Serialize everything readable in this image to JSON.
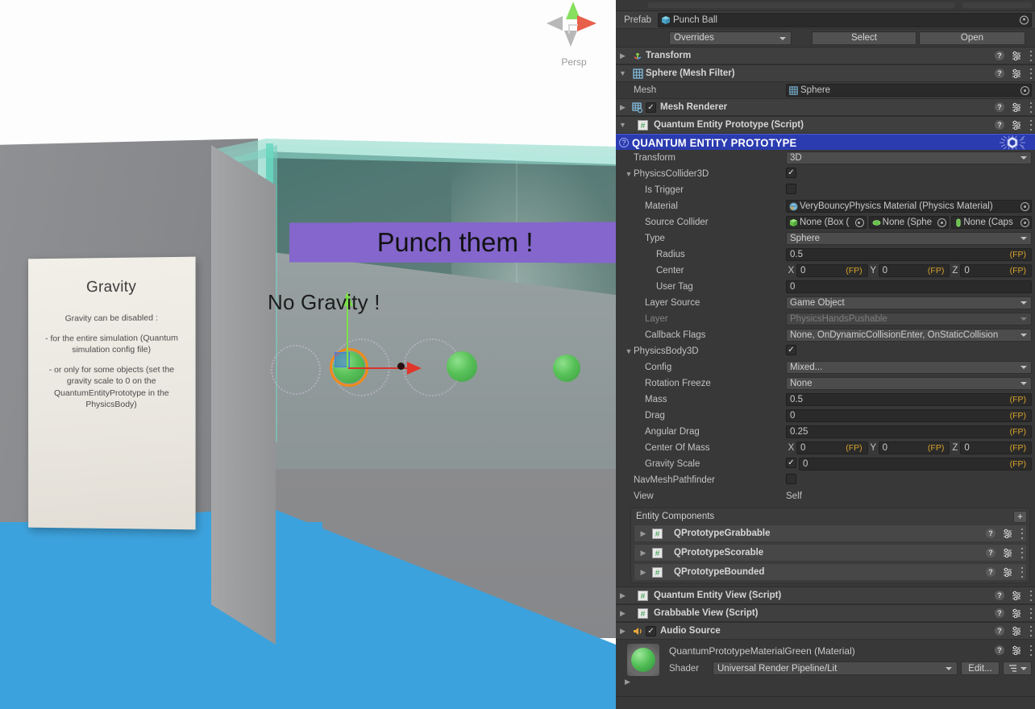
{
  "scene": {
    "gizmo": {
      "label": "Persp",
      "name": "scene-view-gizmo"
    },
    "gravity_panel": {
      "title": "Gravity",
      "line1": "Gravity can be disabled :",
      "line2": "- for the entire simulation (Quantum simulation config file)",
      "line3": "- or only for some objects (set the gravity scale to 0 on the QuantumEntityPrototype in the PhysicsBody)"
    },
    "banner_text": "Punch them !",
    "no_gravity_text": "No Gravity !",
    "colors": {
      "floor": "#3ca2dd",
      "banner": "#8466cc",
      "glass": "#91dbcd",
      "sphere": "#52bf55",
      "selection_ring": "#f08a1a",
      "axis_y": "#7ce04a",
      "axis_x": "#d9342b"
    }
  },
  "inspector": {
    "prefab": {
      "label": "Prefab",
      "value": "Punch Ball",
      "overrides_label": "Overrides",
      "select_label": "Select",
      "open_label": "Open"
    },
    "components": [
      {
        "title": "Transform",
        "icon": "transform-icon",
        "expanded": false,
        "has_checkbox": false
      },
      {
        "title": "Sphere (Mesh Filter)",
        "icon": "mesh-filter-icon",
        "expanded": true,
        "has_checkbox": false
      },
      {
        "title": "Mesh Renderer",
        "icon": "mesh-renderer-icon",
        "expanded": false,
        "has_checkbox": true,
        "checked": true
      },
      {
        "title": "Quantum Entity Prototype (Script)",
        "icon": "script-icon",
        "expanded": true,
        "has_checkbox": false
      }
    ],
    "mesh_row": {
      "label": "Mesh",
      "value": "Sphere"
    },
    "quantum_banner": {
      "title": "QUANTUM ENTITY PROTOTYPE"
    },
    "fields": {
      "transform": {
        "label": "Transform",
        "value": "3D"
      },
      "physics_collider_3d": {
        "label": "PhysicsCollider3D",
        "checked": true
      },
      "is_trigger": {
        "label": "Is Trigger",
        "checked": false
      },
      "material": {
        "label": "Material",
        "value": "VeryBouncyPhysics Material (Physics Material)"
      },
      "source_collider": {
        "label": "Source Collider",
        "values": [
          "None (Box (",
          "None (Sphe",
          "None (Caps"
        ]
      },
      "type": {
        "label": "Type",
        "value": "Sphere"
      },
      "radius": {
        "label": "Radius",
        "value": "0.5",
        "suffix": "(FP)"
      },
      "center": {
        "label": "Center",
        "x": "0",
        "y": "0",
        "z": "0",
        "suffix": "(FP)"
      },
      "user_tag": {
        "label": "User Tag",
        "value": "0"
      },
      "layer_source": {
        "label": "Layer Source",
        "value": "Game Object"
      },
      "layer": {
        "label": "Layer",
        "value": "PhysicsHandsPushable",
        "disabled": true
      },
      "callback_flags": {
        "label": "Callback Flags",
        "value": "None, OnDynamicCollisionEnter, OnStaticCollision"
      },
      "physics_body_3d": {
        "label": "PhysicsBody3D",
        "checked": true
      },
      "config": {
        "label": "Config",
        "value": "Mixed..."
      },
      "rotation_freeze": {
        "label": "Rotation Freeze",
        "value": "None"
      },
      "mass": {
        "label": "Mass",
        "value": "0.5",
        "suffix": "(FP)"
      },
      "drag": {
        "label": "Drag",
        "value": "0",
        "suffix": "(FP)"
      },
      "angular_drag": {
        "label": "Angular Drag",
        "value": "0.25",
        "suffix": "(FP)"
      },
      "center_of_mass": {
        "label": "Center Of Mass",
        "x": "0",
        "y": "0",
        "z": "0",
        "suffix": "(FP)"
      },
      "gravity_scale": {
        "label": "Gravity Scale",
        "checked": true,
        "value": "0",
        "suffix": "(FP)"
      },
      "nav_mesh_pathfinder": {
        "label": "NavMeshPathfinder",
        "checked": false
      },
      "view": {
        "label": "View",
        "value": "Self"
      }
    },
    "axis_labels": {
      "x": "X",
      "y": "Y",
      "z": "Z"
    },
    "entity_components": {
      "title": "Entity Components",
      "add_label": "+",
      "items": [
        {
          "name": "QPrototypeGrabbable"
        },
        {
          "name": "QPrototypeScorable"
        },
        {
          "name": "QPrototypeBounded"
        }
      ]
    },
    "bottom_components": [
      {
        "title": "Quantum Entity View (Script)",
        "icon": "script-icon",
        "has_checkbox": false
      },
      {
        "title": "Grabbable View (Script)",
        "icon": "script-icon",
        "has_checkbox": false
      },
      {
        "title": "Audio Source",
        "icon": "audio-source-icon",
        "has_checkbox": true,
        "checked": true
      }
    ],
    "material_block": {
      "title": "QuantumPrototypeMaterialGreen (Material)",
      "shader_label": "Shader",
      "shader_value": "Universal Render Pipeline/Lit",
      "edit_label": "Edit...",
      "colors": {
        "preview": "#52bf55"
      }
    }
  }
}
